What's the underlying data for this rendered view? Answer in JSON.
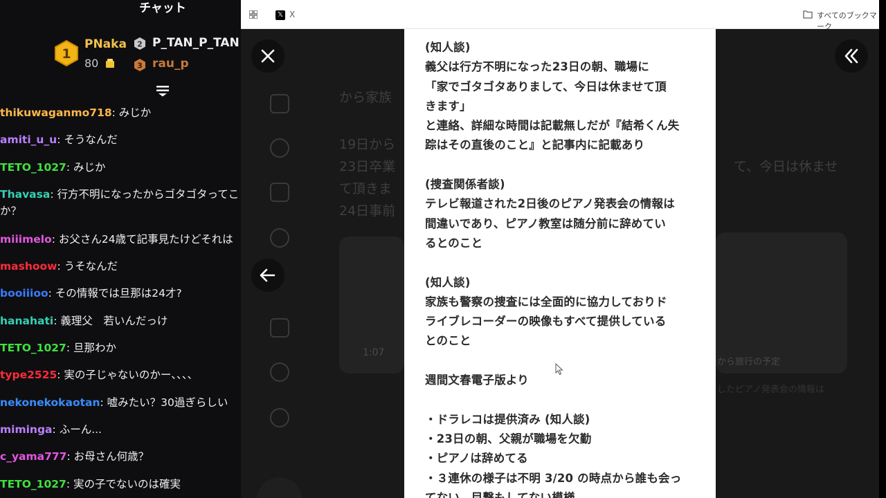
{
  "chat": {
    "title": "チャット",
    "leaderboard": {
      "first": {
        "rank": "1",
        "name": "PNaka",
        "score": "80"
      },
      "second": {
        "rank": "2",
        "name": "P_TAN_P_TAN"
      },
      "third": {
        "rank": "3",
        "name": "rau_p"
      }
    },
    "messages": [
      {
        "user": "thikuwaganmo718",
        "color": "#ffb84a",
        "text": " みじか"
      },
      {
        "user": "amiti_u_u",
        "color": "#b980ff",
        "text": " そうなんだ"
      },
      {
        "user": "TETO_1027",
        "color": "#3fe03f",
        "text": " みじか"
      },
      {
        "user": "Thavasa",
        "color": "#35d1b3",
        "text": " 行方不明になったからゴタゴタってこと"
      },
      {
        "user": "",
        "color": "#efeff1",
        "text": "か？"
      },
      {
        "user": "miiimelo",
        "color": "#e356e3",
        "text": " お父さん24歳て記事見たけどそれは"
      },
      {
        "user": "mashoow",
        "color": "#ff2b3b",
        "text": " うそなんだ"
      },
      {
        "user": "booiiioo",
        "color": "#3a7bff",
        "text": " その情報では旦那は24才?"
      },
      {
        "user": "hanahati",
        "color": "#35d1b3",
        "text": " 義理父　若いんだっけ"
      },
      {
        "user": "TETO_1027",
        "color": "#3fe03f",
        "text": " 旦那わか"
      },
      {
        "user": "type2525",
        "color": "#ff2b3b",
        "text": " 実の子じゃないのかー、、、、"
      },
      {
        "user": "nekonekokaotan",
        "color": "#3a8cff",
        "text": " 嘘みたい？30過ぎらしい"
      },
      {
        "user": "miminga",
        "color": "#b980ff",
        "text": " ふーん..."
      },
      {
        "user": "c_yama777",
        "color": "#e356e3",
        "text": " お母さん何歳？"
      },
      {
        "user": "TETO_1027",
        "color": "#3fe03f",
        "text": " 実の子でないのは確実"
      }
    ]
  },
  "browser": {
    "tab_label": "X",
    "bookmarks_label": "すべてのブックマーク"
  },
  "background": {
    "texts": [
      "から家族",
      "19日から",
      "23日卒業",
      "て頂きま",
      "24日事前",
      "て、今日は休ませ",
      "1:07",
      "から旅行の予定",
      "したピアノ発表会の情報は"
    ]
  },
  "document": {
    "lines": [
      "(知人談)",
      "義父は行方不明になった23日の朝、職場に",
      "「家でゴタゴタありまして、今日は休ませて頂",
      "きます」",
      "と連絡、詳細な時間は記載無しだが『結希くん失",
      "踪はその直後のこと』と記事内に記載あり",
      "",
      "(捜査関係者談)",
      "テレビ報道された2日後のピアノ発表会の情報は",
      "間違いであり、ピアノ教室は随分前に辞めてい",
      "るとのこと",
      "",
      "(知人談)",
      "家族も警察の捜査には全面的に協力しておりド",
      "ライブレコーダーの映像もすべて提供している",
      "とのこと",
      "",
      "週間文春電子版より",
      "",
      "・ドラレコは提供済み (知人談)",
      "・23日の朝、父親が職場を欠勤",
      "・ピアノは辞めてる",
      "・３連休の様子は不明 3/20 の時点から誰も会っ",
      "てない、目撃もしてない模様"
    ]
  }
}
